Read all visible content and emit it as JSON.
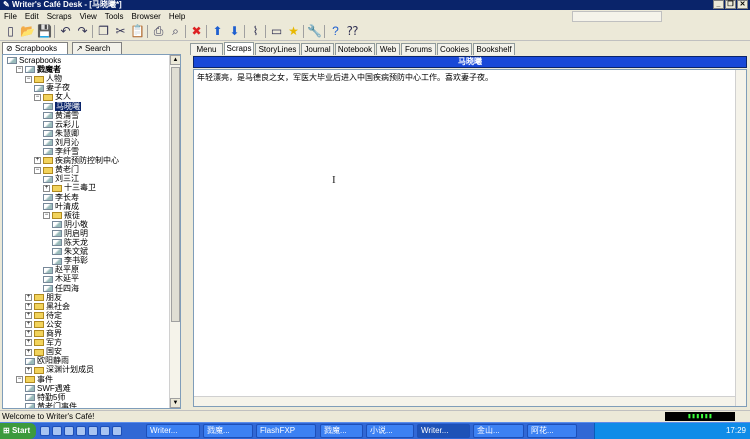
{
  "window": {
    "title": "Writer's Café Desk - [马晓曦*]"
  },
  "menubar": {
    "items": [
      "File",
      "Edit",
      "Scraps",
      "View",
      "Tools",
      "Browser",
      "Help"
    ]
  },
  "toolbar": {
    "icons": [
      "new-icon",
      "open-icon",
      "save-icon",
      "undo-icon",
      "redo-icon",
      "copy-icon",
      "cut-icon",
      "paste-icon",
      "print-icon",
      "find-icon",
      "delete-icon",
      "up-icon",
      "down-icon",
      "attach-icon",
      "frame-icon",
      "star-icon",
      "tools-icon",
      "help-icon",
      "whats-this-icon"
    ]
  },
  "left_tabs": [
    "Scrapbooks",
    "Search"
  ],
  "tree": [
    {
      "label": "Scrapbooks",
      "level": 0,
      "type": "root",
      "exp": ""
    },
    {
      "label": "戮魔者",
      "level": 1,
      "type": "book",
      "exp": "−",
      "bold": true
    },
    {
      "label": "人物",
      "level": 2,
      "type": "folder",
      "exp": "−"
    },
    {
      "label": "妻子夜",
      "level": 3,
      "type": "doc",
      "exp": ""
    },
    {
      "label": "女人",
      "level": 3,
      "type": "folder",
      "exp": "−"
    },
    {
      "label": "马晓曦",
      "level": 4,
      "type": "doc",
      "exp": "",
      "selected": true
    },
    {
      "label": "黄浦雪",
      "level": 4,
      "type": "doc",
      "exp": ""
    },
    {
      "label": "云彩儿",
      "level": 4,
      "type": "doc",
      "exp": ""
    },
    {
      "label": "朱慧卿",
      "level": 4,
      "type": "doc",
      "exp": ""
    },
    {
      "label": "刘月沁",
      "level": 4,
      "type": "doc",
      "exp": ""
    },
    {
      "label": "李纤雪",
      "level": 4,
      "type": "doc",
      "exp": ""
    },
    {
      "label": "疾病预防控制中心",
      "level": 3,
      "type": "folder",
      "exp": "+"
    },
    {
      "label": "黄老门",
      "level": 3,
      "type": "folder",
      "exp": "−"
    },
    {
      "label": "刘三江",
      "level": 4,
      "type": "doc",
      "exp": ""
    },
    {
      "label": "十三毒卫",
      "level": 4,
      "type": "folder",
      "exp": "+"
    },
    {
      "label": "李长寿",
      "level": 4,
      "type": "doc",
      "exp": ""
    },
    {
      "label": "叶清成",
      "level": 4,
      "type": "doc",
      "exp": ""
    },
    {
      "label": "叛徒",
      "level": 4,
      "type": "folder",
      "exp": "−"
    },
    {
      "label": "阴小敬",
      "level": 5,
      "type": "doc",
      "exp": ""
    },
    {
      "label": "阴启明",
      "level": 5,
      "type": "doc",
      "exp": ""
    },
    {
      "label": "陈天龙",
      "level": 5,
      "type": "doc",
      "exp": ""
    },
    {
      "label": "朱文斌",
      "level": 5,
      "type": "doc",
      "exp": ""
    },
    {
      "label": "李书彰",
      "level": 5,
      "type": "doc",
      "exp": ""
    },
    {
      "label": "赵平原",
      "level": 4,
      "type": "doc",
      "exp": ""
    },
    {
      "label": "木延平",
      "level": 4,
      "type": "doc",
      "exp": ""
    },
    {
      "label": "任四海",
      "level": 4,
      "type": "doc",
      "exp": ""
    },
    {
      "label": "朋友",
      "level": 2,
      "type": "folder",
      "exp": "+"
    },
    {
      "label": "黑社会",
      "level": 2,
      "type": "folder",
      "exp": "+"
    },
    {
      "label": "待定",
      "level": 2,
      "type": "folder",
      "exp": "+"
    },
    {
      "label": "公安",
      "level": 2,
      "type": "folder",
      "exp": "+"
    },
    {
      "label": "商界",
      "level": 2,
      "type": "folder",
      "exp": "+"
    },
    {
      "label": "军方",
      "level": 2,
      "type": "folder",
      "exp": "+"
    },
    {
      "label": "国安",
      "level": 2,
      "type": "folder",
      "exp": "+"
    },
    {
      "label": "欧阳静雨",
      "level": 2,
      "type": "doc",
      "exp": ""
    },
    {
      "label": "深渊计划成员",
      "level": 2,
      "type": "folder",
      "exp": "+"
    },
    {
      "label": "事件",
      "level": 1,
      "type": "folder",
      "exp": "−"
    },
    {
      "label": "SWF遇难",
      "level": 2,
      "type": "doc",
      "exp": ""
    },
    {
      "label": "特勤5师",
      "level": 2,
      "type": "doc",
      "exp": ""
    },
    {
      "label": "黄老门事件",
      "level": 2,
      "type": "doc",
      "exp": ""
    }
  ],
  "right_tabs": [
    "Menu",
    "Scraps",
    "StoryLines",
    "Journal",
    "Notebook",
    "Web",
    "Forums",
    "Cookies",
    "Bookshelf"
  ],
  "active_tab": "Scraps",
  "scrap": {
    "title": "马晓曦",
    "body": "年轻漂亮，是马德良之女，军医大毕业后进入中国疾病预防中心工作。喜欢妻子夜。"
  },
  "status": {
    "text": "Welcome to Writer's Café!"
  },
  "taskbar": {
    "start_label": "Start",
    "tasks": [
      "Writer...",
      "戮魔...",
      "FlashFXP",
      "戮魔...",
      "小说...",
      "Writer...",
      "金山...",
      "阿花..."
    ],
    "active_task": 5,
    "clock": "17:29"
  }
}
